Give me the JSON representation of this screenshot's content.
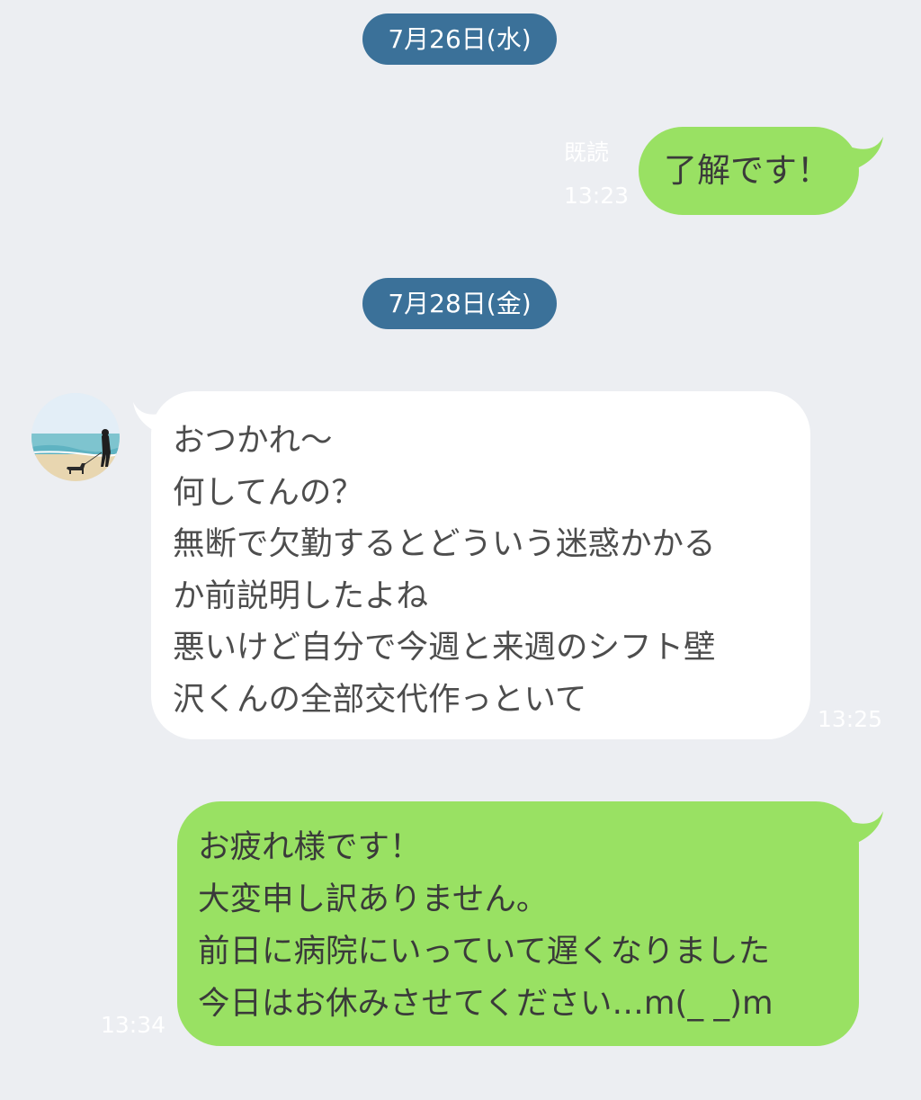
{
  "chat": {
    "date_1": "7月26日(水)",
    "date_2": "7月28日(金)",
    "messages": [
      {
        "direction": "outgoing",
        "read_label": "既読",
        "time": "13:23",
        "lines": [
          "了解です！"
        ]
      },
      {
        "direction": "incoming",
        "time": "13:25",
        "lines": [
          "おつかれ〜",
          "何してんの？",
          "無断で欠勤するとどういう迷惑かかる",
          "か前説明したよね",
          "悪いけど自分で今週と来週のシフト壁",
          "沢くんの全部交代作っといて"
        ]
      },
      {
        "direction": "outgoing",
        "time": "13:34",
        "lines": [
          "お疲れ様です！",
          "大変申し訳ありません。",
          "前日に病院にいっていて遅くなりました",
          "今日はお休みさせてください…m(_ _)m"
        ]
      }
    ]
  },
  "avatar_icon": "beach-dog-walker-avatar",
  "colors": {
    "background": "#eceef2",
    "date_pill": "#3b7199",
    "outgoing_bubble": "#99e163",
    "incoming_bubble": "#ffffff"
  }
}
